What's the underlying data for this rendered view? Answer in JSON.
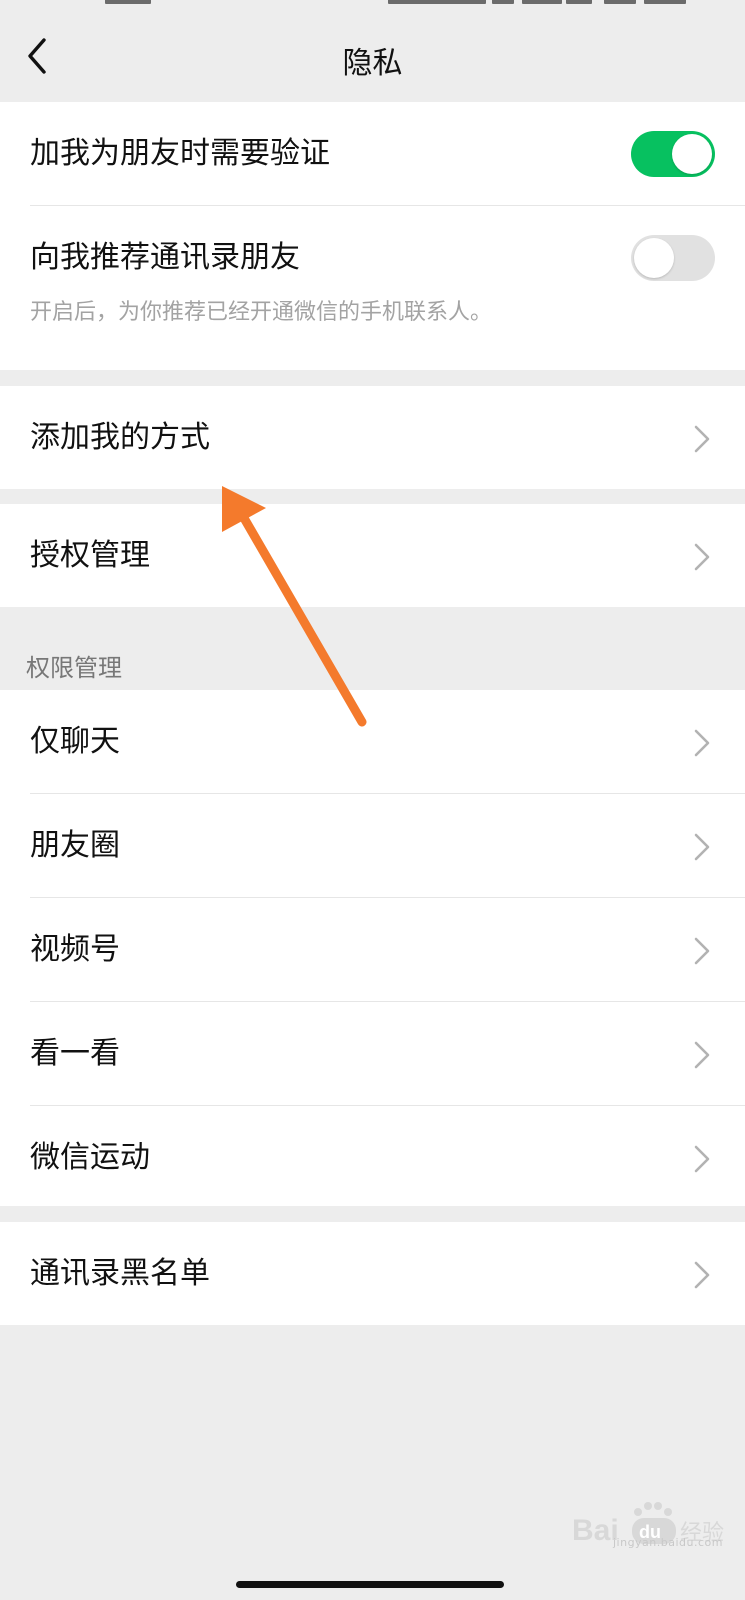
{
  "header": {
    "title": "隐私"
  },
  "privacy_toggles": [
    {
      "label": "加我为朋友时需要验证",
      "enabled": true
    },
    {
      "label": "向我推荐通讯录朋友",
      "enabled": false,
      "description": "开启后，为你推荐已经开通微信的手机联系人。"
    }
  ],
  "add_me_methods": {
    "label": "添加我的方式"
  },
  "authorization": {
    "label": "授权管理"
  },
  "permissions": {
    "section_title": "权限管理",
    "items": [
      {
        "label": "仅聊天"
      },
      {
        "label": "朋友圈"
      },
      {
        "label": "视频号"
      },
      {
        "label": "看一看"
      },
      {
        "label": "微信运动"
      }
    ]
  },
  "blacklist": {
    "label": "通讯录黑名单"
  },
  "watermark": {
    "text": "jingyan.baidu.com",
    "logo_text": "Bai du 经验"
  },
  "colors": {
    "accent_green": "#07c160",
    "annotation_arrow": "#f47a2c"
  }
}
